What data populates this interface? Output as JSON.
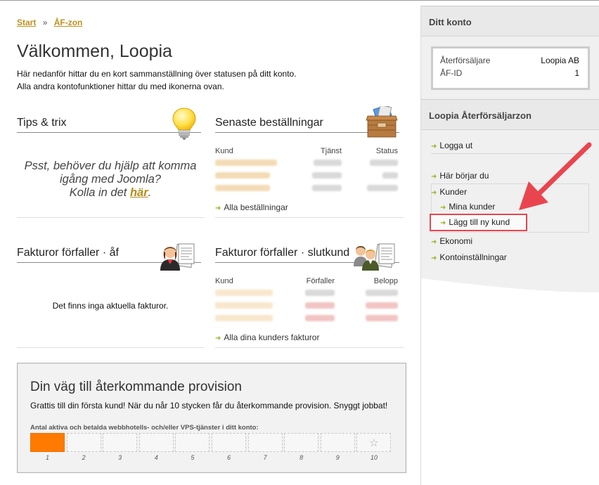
{
  "breadcrumb": {
    "home": "Start",
    "sep": "»",
    "current": "ÅF-zon"
  },
  "page": {
    "title": "Välkommen, Loopia",
    "intro_line1": "Här nedanför hittar du en kort sammanställning över statusen på ditt konto.",
    "intro_line2": "Alla andra kontofunktioner hittar du med ikonerna ovan."
  },
  "tips": {
    "title": "Tips & trix",
    "line1": "Psst, behöver du hjälp att komma",
    "line2": "igång med Joomla?",
    "line3_pre": "Kolla in det ",
    "line3_link": "här",
    "line3_post": "."
  },
  "orders": {
    "title": "Senaste beställningar",
    "col_kund": "Kund",
    "col_tjanst": "Tjänst",
    "col_status": "Status",
    "more_link": "Alla beställningar"
  },
  "invoices_af": {
    "title": "Fakturor förfaller · åf",
    "empty": "Det finns inga aktuella fakturor."
  },
  "invoices_customer": {
    "title": "Fakturor förfaller · slutkund",
    "col_kund": "Kund",
    "col_forfaller": "Förfaller",
    "col_belopp": "Belopp",
    "more_link": "Alla dina kunders fakturor"
  },
  "provision": {
    "title": "Din väg till återkommande provision",
    "desc": "Grattis till din första kund! När du når 10 stycken får du återkommande provision. Snyggt jobbat!",
    "label": "Antal aktiva och betalda webbhotells- och/eller VPS-tjänster i ditt konto:",
    "filled": 1,
    "slots": [
      "1",
      "2",
      "3",
      "4",
      "5",
      "6",
      "7",
      "8",
      "9",
      "10"
    ]
  },
  "sidebar": {
    "account_head": "Ditt konto",
    "reseller_label": "Återförsäljare",
    "reseller_value": "Loopia AB",
    "afid_label": "ÅF-ID",
    "afid_value": "1",
    "zone_head": "Loopia Återförsäljarzon",
    "logout": "Logga ut",
    "start_here": "Här börjar du",
    "customers": "Kunder",
    "my_customers": "Mina kunder",
    "add_customer": "Lägg till ny kund",
    "economy": "Ekonomi",
    "account_settings": "Kontoinställningar"
  },
  "colors": {
    "accent_gold": "#c0901e",
    "arrow_red": "#e9454f",
    "progress_orange": "#ff7a00",
    "bullet_green": "#9bb31c"
  },
  "icons": [
    "lightbulb-icon",
    "package-icon",
    "businesswoman-invoice-icon",
    "customers-invoice-icon",
    "red-arrow-annotation",
    "star-icon"
  ]
}
